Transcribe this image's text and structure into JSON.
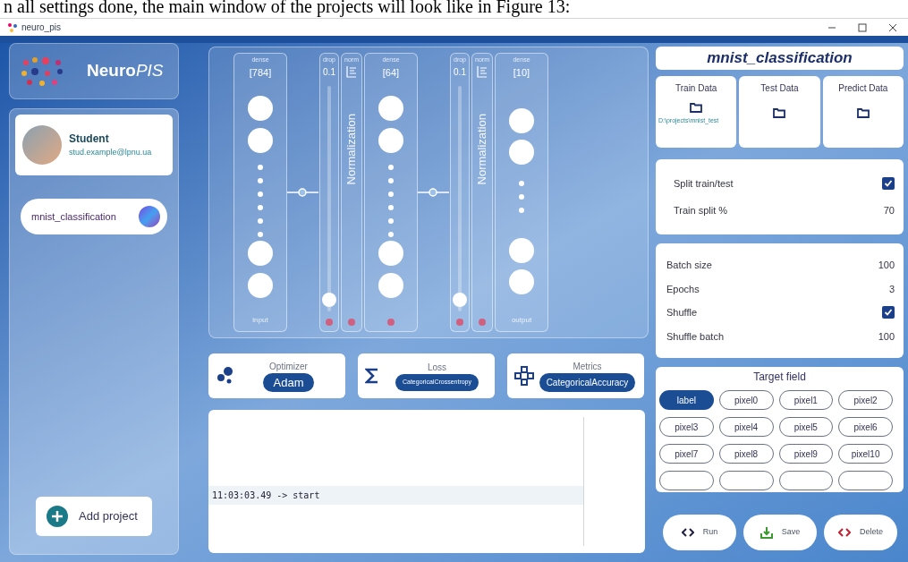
{
  "caption": "n all settings done, the main window of the projects will look like in Figure 13:",
  "window": {
    "title": "neuro_pis"
  },
  "logo": {
    "main": "Neuro",
    "accent": "PIS"
  },
  "user": {
    "name": "Student",
    "email": "stud.example@lpnu.ua"
  },
  "projects": [
    {
      "name": "mnist_classification"
    }
  ],
  "add_project": "Add project",
  "network": {
    "layers": [
      {
        "kind": "dense",
        "type": "dense",
        "units": "[784]",
        "footer": "input"
      },
      {
        "kind": "dropout",
        "type": "drop",
        "rate": "0.1",
        "level": 0.05
      },
      {
        "kind": "normalization",
        "type": "norm",
        "label": "Normalization"
      },
      {
        "kind": "dense",
        "type": "dense",
        "units": "[64]"
      },
      {
        "kind": "dropout",
        "type": "drop",
        "rate": "0.1",
        "level": 0.05
      },
      {
        "kind": "normalization",
        "type": "norm",
        "label": "Normalization"
      },
      {
        "kind": "dense",
        "type": "dense",
        "units": "[10]",
        "footer": "output"
      }
    ]
  },
  "compile": [
    {
      "kind": "optimizer",
      "label": "Optimizer",
      "value": "Adam"
    },
    {
      "kind": "loss",
      "label": "Loss",
      "value": "CategoricalCrossentropy"
    },
    {
      "kind": "metrics",
      "label": "Metrics",
      "value": "CategoricalAccuracy"
    }
  ],
  "log": [
    {
      "text": "11:03:03.49 -> start",
      "selected": true
    }
  ],
  "project_title": "mnist_classification",
  "data_sources": [
    {
      "label": "Train Data",
      "path": "D:\\projects\\mnist_test"
    },
    {
      "label": "Test Data"
    },
    {
      "label": "Predict Data"
    }
  ],
  "split": [
    {
      "kind": "checkbox",
      "label": "Split train/test",
      "checked": true
    },
    {
      "kind": "value",
      "label": "Train split %",
      "value": "70"
    }
  ],
  "training": [
    {
      "kind": "value",
      "label": "Batch size",
      "value": "100"
    },
    {
      "kind": "value",
      "label": "Epochs",
      "value": "3"
    },
    {
      "kind": "checkbox",
      "label": "Shuffle",
      "checked": true
    },
    {
      "kind": "value",
      "label": "Shuffle batch",
      "value": "100"
    }
  ],
  "target_field": {
    "title": "Target field",
    "options": [
      {
        "label": "label",
        "selected": true
      },
      {
        "label": "pixel0",
        "selected": false
      },
      {
        "label": "pixel1",
        "selected": false
      },
      {
        "label": "pixel2",
        "selected": false
      },
      {
        "label": "pixel3",
        "selected": false
      },
      {
        "label": "pixel4",
        "selected": false
      },
      {
        "label": "pixel5",
        "selected": false
      },
      {
        "label": "pixel6",
        "selected": false
      },
      {
        "label": "pixel7",
        "selected": false
      },
      {
        "label": "pixel8",
        "selected": false
      },
      {
        "label": "pixel9",
        "selected": false
      },
      {
        "label": "pixel10",
        "selected": false
      }
    ]
  },
  "actions": [
    {
      "kind": "run",
      "label": "Run"
    },
    {
      "kind": "save",
      "label": "Save"
    },
    {
      "kind": "delete",
      "label": "Delete"
    }
  ]
}
